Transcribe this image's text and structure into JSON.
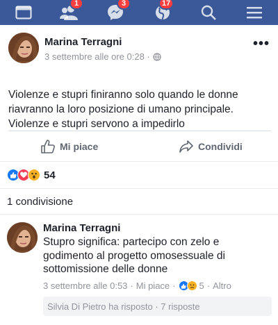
{
  "nav": {
    "items": [
      {
        "icon": "browser-window-icon",
        "badge": ""
      },
      {
        "icon": "friend-requests-icon",
        "badge": "1"
      },
      {
        "icon": "messenger-icon",
        "badge": "3"
      },
      {
        "icon": "globe-notifications-icon",
        "badge": "17"
      },
      {
        "icon": "search-icon",
        "badge": ""
      },
      {
        "icon": "menu-icon",
        "badge": ""
      }
    ],
    "bar_color": "#3b5998"
  },
  "post": {
    "author": "Marina Terragni",
    "timestamp": "3 settembre alle ore 0:28 ·",
    "privacy_icon": "globe-icon",
    "more_label": "•••",
    "text_lines": [
      "Violenze e stupri finiranno solo quando le donne",
      "riavranno la loro posizione di umano principale.",
      "Violenze e stupri servono a impedirlo"
    ],
    "like_label": "Mi piace",
    "share_label": "Condividi"
  },
  "reactions": {
    "icons": [
      "like-reaction-icon",
      "love-reaction-icon",
      "wow-reaction-icon"
    ],
    "count": "54"
  },
  "shares": {
    "label": "1 condivisione"
  },
  "comment": {
    "author": "Marina Terragni",
    "text_lines": [
      "Stupro significa: partecipo con zelo e",
      "godimento al progetto omosessuale di",
      "sottomissione delle donne"
    ],
    "date": "3 settembre alle 0:53",
    "sep1": "·",
    "like_label": "Mi piace",
    "sep2": "·",
    "reaction_count": "5",
    "sep3": "·",
    "more_label": "Altro",
    "reply_summary": "Silvia Di Pietro ha risposto · 7 risposte"
  }
}
